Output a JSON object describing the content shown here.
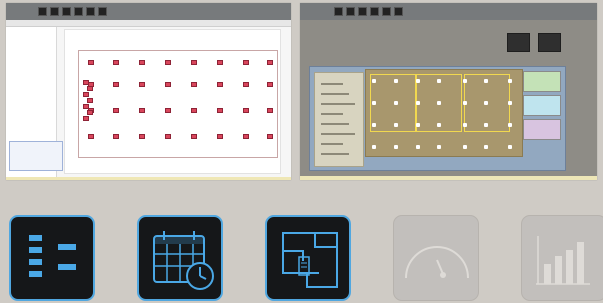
{
  "screens": [
    {
      "id": "left",
      "title": "",
      "panel": "plan-editor"
    },
    {
      "id": "right",
      "title": "",
      "label": "",
      "panel": "floor-monitor"
    }
  ],
  "nav": [
    {
      "name": "list-view",
      "icon": "list-icon",
      "state": "active"
    },
    {
      "name": "schedule",
      "icon": "calendar-clock-icon",
      "state": "active"
    },
    {
      "name": "floor-plan",
      "icon": "floor-plan-icon",
      "state": "active"
    },
    {
      "name": "gauge",
      "icon": "gauge-icon",
      "state": "disabled"
    },
    {
      "name": "reports",
      "icon": "bar-chart-icon",
      "state": "disabled"
    }
  ],
  "colors": {
    "background": "#cfcbc5",
    "active_border": "#50a7e0",
    "active_fill": "#151719",
    "disabled_fill": "#c2bfbc",
    "sensor_red": "#d9465c",
    "room_yellow": "#f1d84f",
    "panel_blue": "#92a8c0"
  }
}
